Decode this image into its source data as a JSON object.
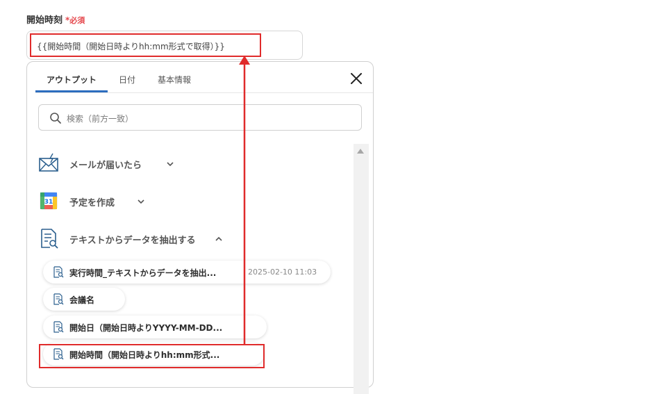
{
  "field": {
    "label": "開始時刻",
    "required_mark": "*",
    "required_text": "必須",
    "value": "{{開始時間（開始日時よりhh:mm形式で取得）}}"
  },
  "tabs": [
    {
      "label": "アウトプット",
      "active": true
    },
    {
      "label": "日付",
      "active": false
    },
    {
      "label": "基本情報",
      "active": false
    }
  ],
  "search": {
    "placeholder": "検索（前方一致）"
  },
  "sections": [
    {
      "label": "メールが届いたら",
      "icon": "mail-icon",
      "expanded": false
    },
    {
      "label": "予定を作成",
      "icon": "google-calendar-icon",
      "icon_text": "31",
      "expanded": false
    },
    {
      "label": "テキストからデータを抽出する",
      "icon": "text-extract-icon",
      "expanded": true
    }
  ],
  "items": [
    {
      "label": "実行時間_テキストからデータを抽出...",
      "meta": "2025-02-10 11:03"
    },
    {
      "label": "会議名",
      "meta": ""
    },
    {
      "label": "開始日（開始日時よりYYYY-MM-DD...",
      "meta": ""
    },
    {
      "label": "開始時間（開始日時よりhh:mm形式...",
      "meta": ""
    }
  ],
  "colors": {
    "accent": "#2c6dbf",
    "required": "#e5484d",
    "highlight": "#e02b2b"
  }
}
